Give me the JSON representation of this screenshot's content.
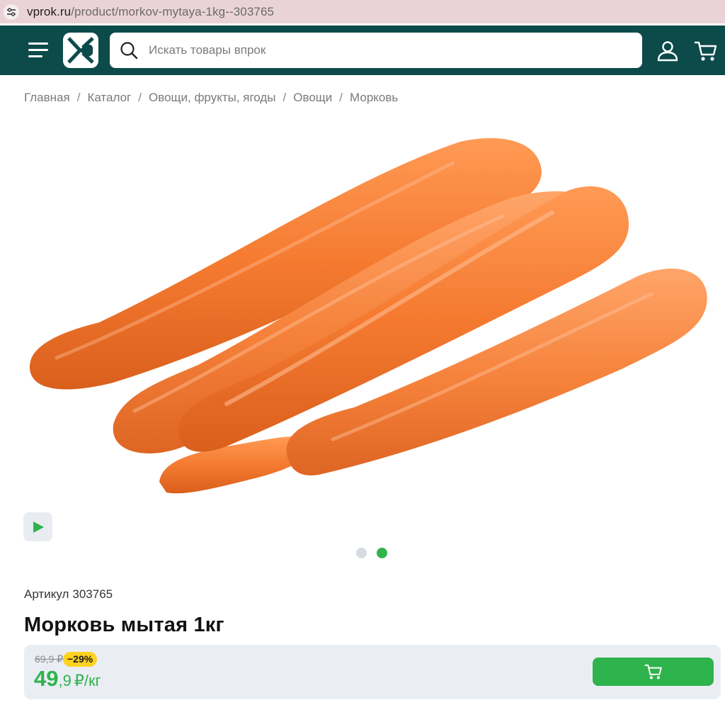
{
  "browser": {
    "url_host": "vprok.ru",
    "url_path": "/product/morkov-mytaya-1kg--303765",
    "tune_icon": "site-settings-icon"
  },
  "header": {
    "menu_icon": "hamburger-menu-icon",
    "logo_icon": "vprok-logo-icon",
    "search_placeholder": "Искать товары впрок",
    "search_icon": "search-icon",
    "profile_icon": "user-icon",
    "cart_icon": "cart-icon"
  },
  "breadcrumb": [
    {
      "label": "Главная"
    },
    {
      "label": "Каталог"
    },
    {
      "label": "Овощи, фрукты, ягоды"
    },
    {
      "label": "Овощи"
    },
    {
      "label": "Морковь"
    }
  ],
  "breadcrumb_separator": "/",
  "gallery": {
    "play_icon": "play-icon",
    "slides_total": 2,
    "active_slide": 2
  },
  "product": {
    "sku_label": "Артикул",
    "sku": "303765",
    "title": "Морковь мытая 1кг",
    "old_price": "69,9 ₽",
    "discount": "−29%",
    "price_int": "49",
    "price_frac": ",9",
    "price_unit": "₽/кг",
    "cart_button_icon": "cart-icon"
  },
  "colors": {
    "header_bg": "#0d4a4a",
    "accent_green": "#2fb34c",
    "discount_yellow": "#ffd21f",
    "carrot_orange": "#f57a30"
  }
}
